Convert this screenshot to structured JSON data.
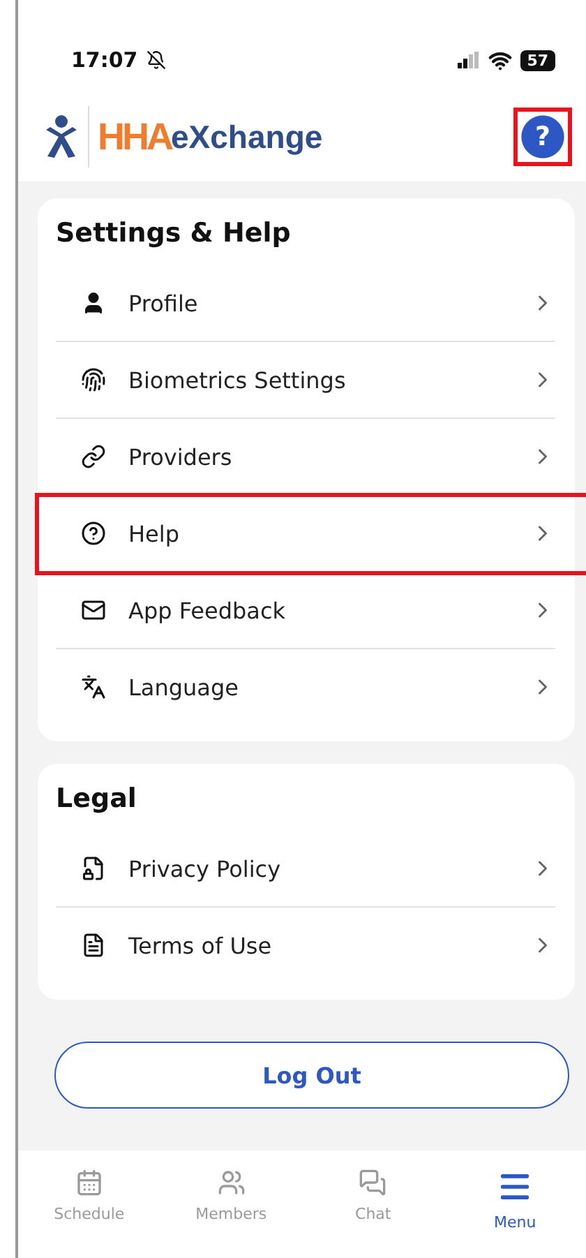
{
  "status_bar": {
    "time": "17:07",
    "battery": "57"
  },
  "header": {
    "logo_primary": "HHA",
    "logo_secondary": "eXchange",
    "help_button": {
      "label": "?",
      "highlighted": true
    }
  },
  "sections": [
    {
      "title": "Settings & Help",
      "items": [
        {
          "label": "Profile",
          "highlighted": false
        },
        {
          "label": "Biometrics Settings",
          "highlighted": false
        },
        {
          "label": "Providers",
          "highlighted": false
        },
        {
          "label": "Help",
          "highlighted": true
        },
        {
          "label": "App Feedback",
          "highlighted": false
        },
        {
          "label": "Language",
          "highlighted": false
        }
      ]
    },
    {
      "title": "Legal",
      "items": [
        {
          "label": "Privacy Policy",
          "highlighted": false
        },
        {
          "label": "Terms of Use",
          "highlighted": false
        }
      ]
    }
  ],
  "logout_button": "Log Out",
  "tab_bar": [
    {
      "label": "Schedule",
      "selected": false
    },
    {
      "label": "Members",
      "selected": false
    },
    {
      "label": "Chat",
      "selected": false
    },
    {
      "label": "Menu",
      "selected": true
    }
  ]
}
